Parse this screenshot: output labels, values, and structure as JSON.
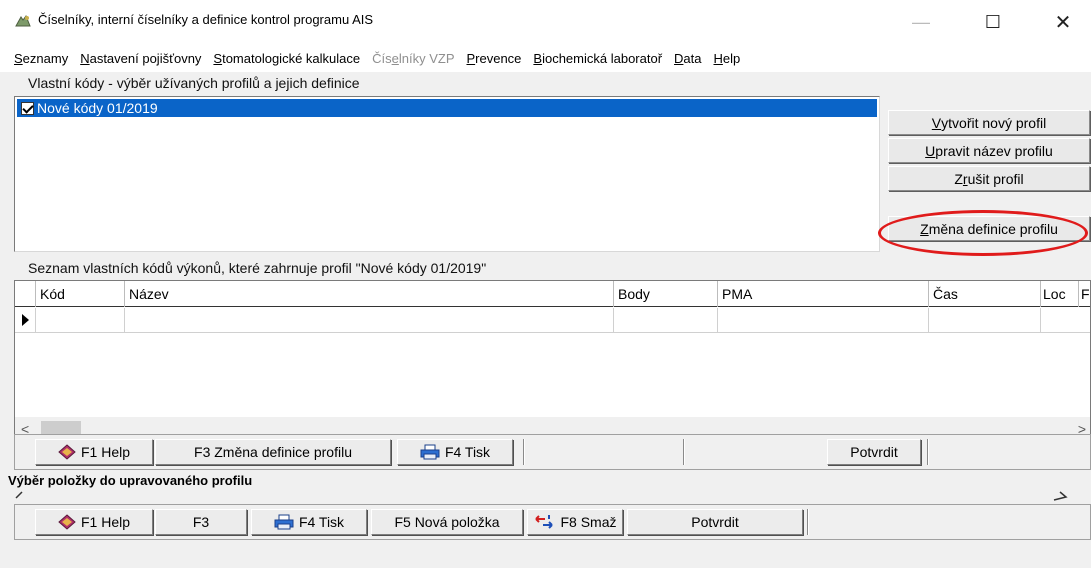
{
  "window": {
    "title": "Číselníky, interní číselníky a definice kontrol programu AIS",
    "minimize": "—",
    "maximize": "☐",
    "close": "✕"
  },
  "menu": [
    {
      "pre": "",
      "ul": "S",
      "post": "eznamy",
      "disabled": false
    },
    {
      "pre": "",
      "ul": "N",
      "post": "astavení pojišťovny",
      "disabled": false
    },
    {
      "pre": "",
      "ul": "S",
      "post": "tomatologické kalkulace",
      "disabled": false
    },
    {
      "pre": "Čís",
      "ul": "e",
      "post": "lníky VZP",
      "disabled": true
    },
    {
      "pre": "",
      "ul": "P",
      "post": "revence",
      "disabled": false
    },
    {
      "pre": "",
      "ul": "B",
      "post": "iochemická laboratoř",
      "disabled": false
    },
    {
      "pre": "",
      "ul": "D",
      "post": "ata",
      "disabled": false
    },
    {
      "pre": "",
      "ul": "H",
      "post": "elp",
      "disabled": false
    }
  ],
  "profiles": {
    "label": "Vlastní kódy - výběr užívaných profilů a jejich definice",
    "items": [
      {
        "label": "Nové kódy 01/2019",
        "checked": true,
        "selected": true
      }
    ]
  },
  "profile_buttons": {
    "create": {
      "pre": "",
      "ul": "V",
      "post": "ytvořit nový profil"
    },
    "rename": {
      "pre": "",
      "ul": "U",
      "post": "pravit název profilu"
    },
    "cancel": {
      "pre": "Z",
      "ul": "r",
      "post": "ušit profil"
    },
    "change": {
      "pre": "",
      "ul": "Z",
      "post": "měna definice profilu"
    }
  },
  "codes": {
    "label": "Seznam vlastních kódů výkonů, které zahrnuje profil \"Nové kódy 01/2019\"",
    "columns": [
      "Kód",
      "Název",
      "Body",
      "PMA",
      "Čas",
      "Loc",
      "F"
    ],
    "scroll_left": "<",
    "scroll_right": ">"
  },
  "toolbar1": {
    "help": "F1 Help",
    "change": "F3 Změna definice profilu",
    "print": "F4 Tisk",
    "confirm": "Potvrdit"
  },
  "lower": {
    "label": "Výběr položky do upravovaného profilu"
  },
  "toolbar2": {
    "help": "F1 Help",
    "f3": "F3",
    "print": "F4 Tisk",
    "new_item": "F5 Nová položka",
    "delete": "F8 Smaž",
    "confirm": "Potvrdit"
  },
  "colors": {
    "selection": "#0a64c8",
    "highlight": "#e01b1b"
  }
}
